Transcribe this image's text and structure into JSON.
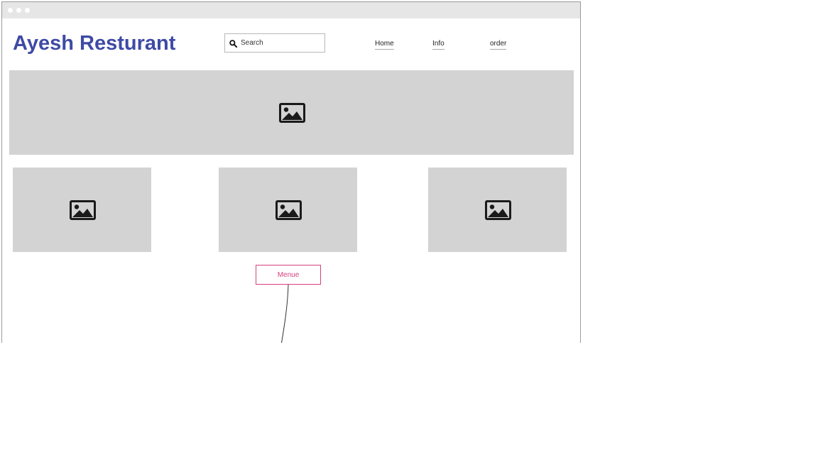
{
  "header": {
    "site_title": "Ayesh Resturant",
    "title_color": "#3f4aa6"
  },
  "search": {
    "placeholder": "Search",
    "icon": "search-icon"
  },
  "nav": {
    "items": [
      {
        "label": "Home"
      },
      {
        "label": "Info"
      },
      {
        "label": "order"
      }
    ]
  },
  "images": {
    "hero": {
      "icon": "image-icon"
    },
    "cards": [
      {
        "icon": "image-icon"
      },
      {
        "icon": "image-icon"
      },
      {
        "icon": "image-icon"
      }
    ],
    "placeholder_color": "#d3d3d3"
  },
  "menu_button": {
    "label": "Menue",
    "color": "#d4417f"
  }
}
